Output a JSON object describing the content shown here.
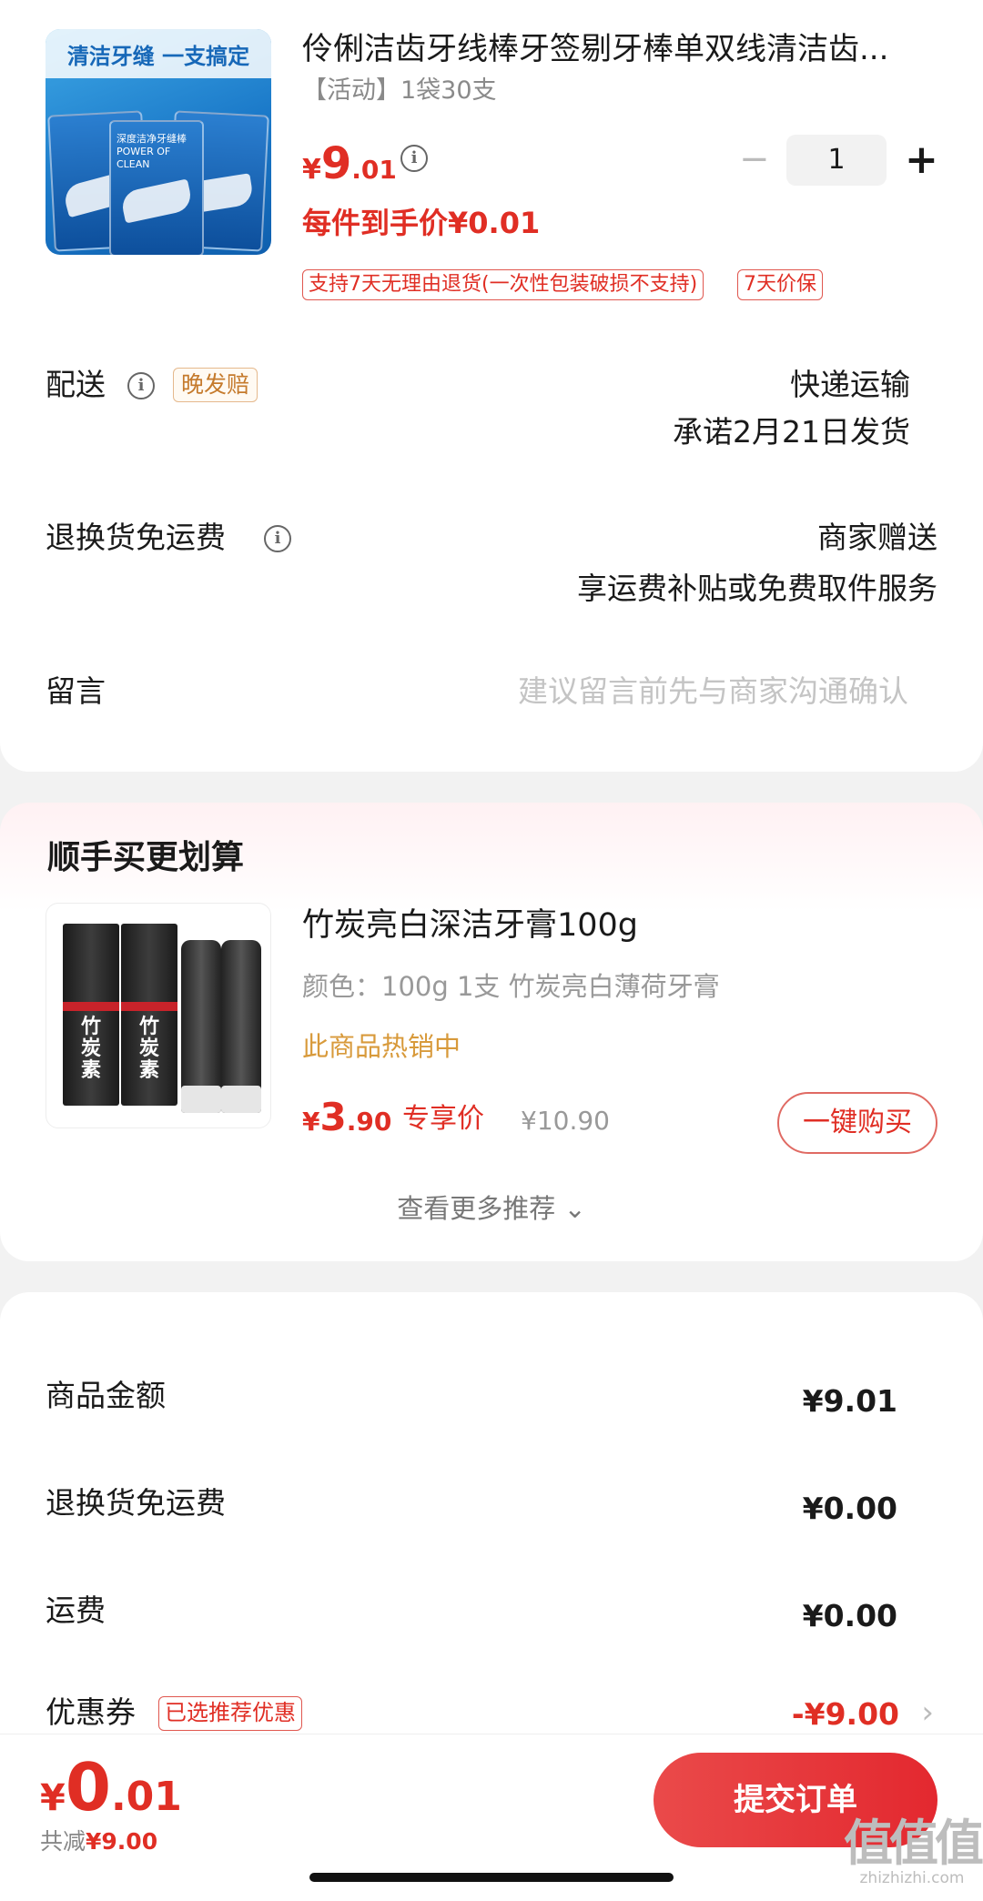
{
  "product": {
    "image_banner": "清洁牙缝 一支搞定",
    "image_pack_text": "深度洁净牙缝棒 POWER OF CLEAN",
    "title": "伶俐洁齿牙线棒牙签剔牙棒单双线清洁齿...",
    "spec": "【活动】1袋30支",
    "price_currency": "¥",
    "price_int": "9",
    "price_dec": ".01",
    "quantity": "1",
    "minus_glyph": "−",
    "plus_glyph": "+",
    "per_item_price": "每件到手价¥0.01",
    "tags": [
      "支持7天无理由退货(一次性包装破损不支持)",
      "7天价保"
    ]
  },
  "delivery": {
    "label": "配送",
    "badge": "晚发赔",
    "method": "快递运输",
    "promise": "承诺2月21日发货"
  },
  "return_shipping": {
    "label": "退换货免运费",
    "value": "商家赠送",
    "detail": "享运费补贴或免费取件服务"
  },
  "message": {
    "label": "留言",
    "placeholder": "建议留言前先与商家沟通确认"
  },
  "recommend": {
    "section_title": "顺手买更划算",
    "item": {
      "box_text": "竹炭素",
      "title": "竹炭亮白深洁牙膏100g",
      "spec": "颜色：100g 1支 竹炭亮白薄荷牙膏",
      "hot": "此商品热销中",
      "price_currency": "¥",
      "price_int": "3",
      "price_dec": ".90",
      "exclusive_label": "专享价",
      "original_price": "¥10.90",
      "buy_label": "一键购买"
    },
    "more_label": "查看更多推荐 ⌄"
  },
  "summary": {
    "rows": [
      {
        "label": "商品金额",
        "value": "¥9.01"
      },
      {
        "label": "退换货免运费",
        "value": "¥0.00"
      },
      {
        "label": "运费",
        "value": "¥0.00"
      },
      {
        "label": "优惠券",
        "badge": "已选推荐优惠",
        "value": "-¥9.00",
        "chevron": "›"
      }
    ]
  },
  "bottom_bar": {
    "total_currency": "¥",
    "total_int": "0",
    "total_dec": ".01",
    "saved_label": "共减",
    "saved_amount": "¥9.00",
    "submit_label": "提交订单"
  },
  "watermark": {
    "glyphs": "值值值",
    "url": "zhizhizhi.com"
  },
  "colors": {
    "accent_red": "#e02e24",
    "gold": "#c57a2c",
    "hot_text": "#d89a3b"
  }
}
